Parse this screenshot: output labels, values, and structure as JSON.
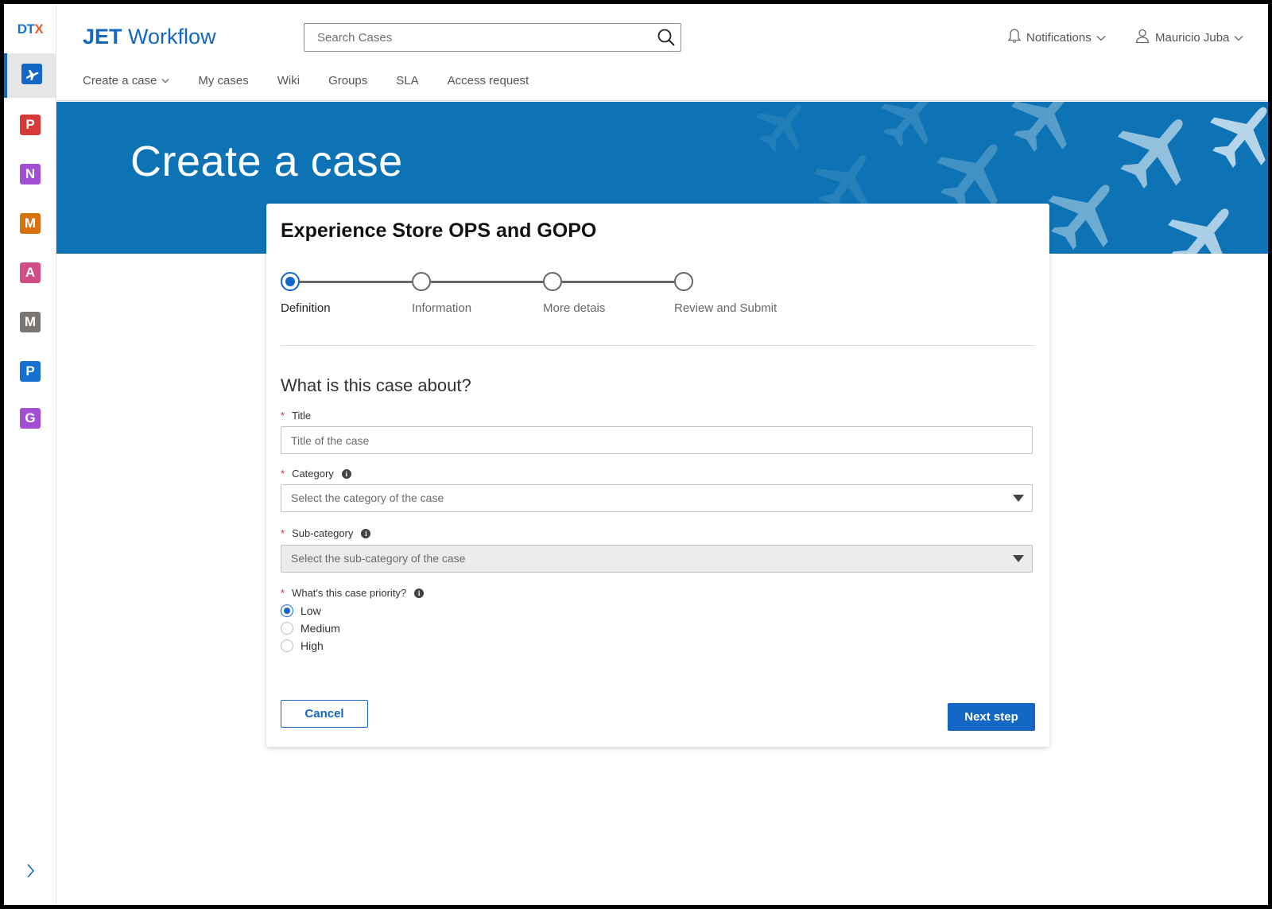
{
  "app": {
    "rail_logo_main": "DT",
    "rail_logo_accent": "X",
    "brand_bold": "JET",
    "brand_rest": "Workflow"
  },
  "rail": {
    "apps": [
      {
        "letter": "P",
        "color": "#d83a3a"
      },
      {
        "letter": "N",
        "color": "#a24fd6"
      },
      {
        "letter": "M",
        "color": "#d8720f"
      },
      {
        "letter": "A",
        "color": "#d14d85"
      },
      {
        "letter": "M",
        "color": "#7a7570"
      },
      {
        "letter": "P",
        "color": "#1670d1"
      },
      {
        "letter": "G",
        "color": "#a24fd6"
      }
    ]
  },
  "search": {
    "placeholder": "Search Cases"
  },
  "header": {
    "notifications": "Notifications",
    "user": "Mauricio Juba"
  },
  "nav": {
    "items": [
      "Create a case",
      "My cases",
      "Wiki",
      "Groups",
      "SLA",
      "Access request"
    ]
  },
  "banner": {
    "title": "Create a case"
  },
  "card": {
    "title": "Experience Store OPS and GOPO",
    "steps": [
      "Definition",
      "Information",
      "More detais",
      "Review and Submit"
    ],
    "question": "What is this case about?"
  },
  "form": {
    "required_mark": "*",
    "title_label": "Title",
    "title_placeholder": "Title of the case",
    "category_label": "Category",
    "category_placeholder": "Select the category of the case",
    "subcategory_label": "Sub-category",
    "subcategory_placeholder": "Select the sub-category of the case",
    "priority_label": "What's this case priority?",
    "priority_options": [
      "Low",
      "Medium",
      "High"
    ],
    "priority_selected": "Low",
    "info_glyph": "i"
  },
  "buttons": {
    "cancel": "Cancel",
    "next": "Next step"
  },
  "colors": {
    "accent": "#1467c4",
    "banner": "#0e73b4"
  }
}
